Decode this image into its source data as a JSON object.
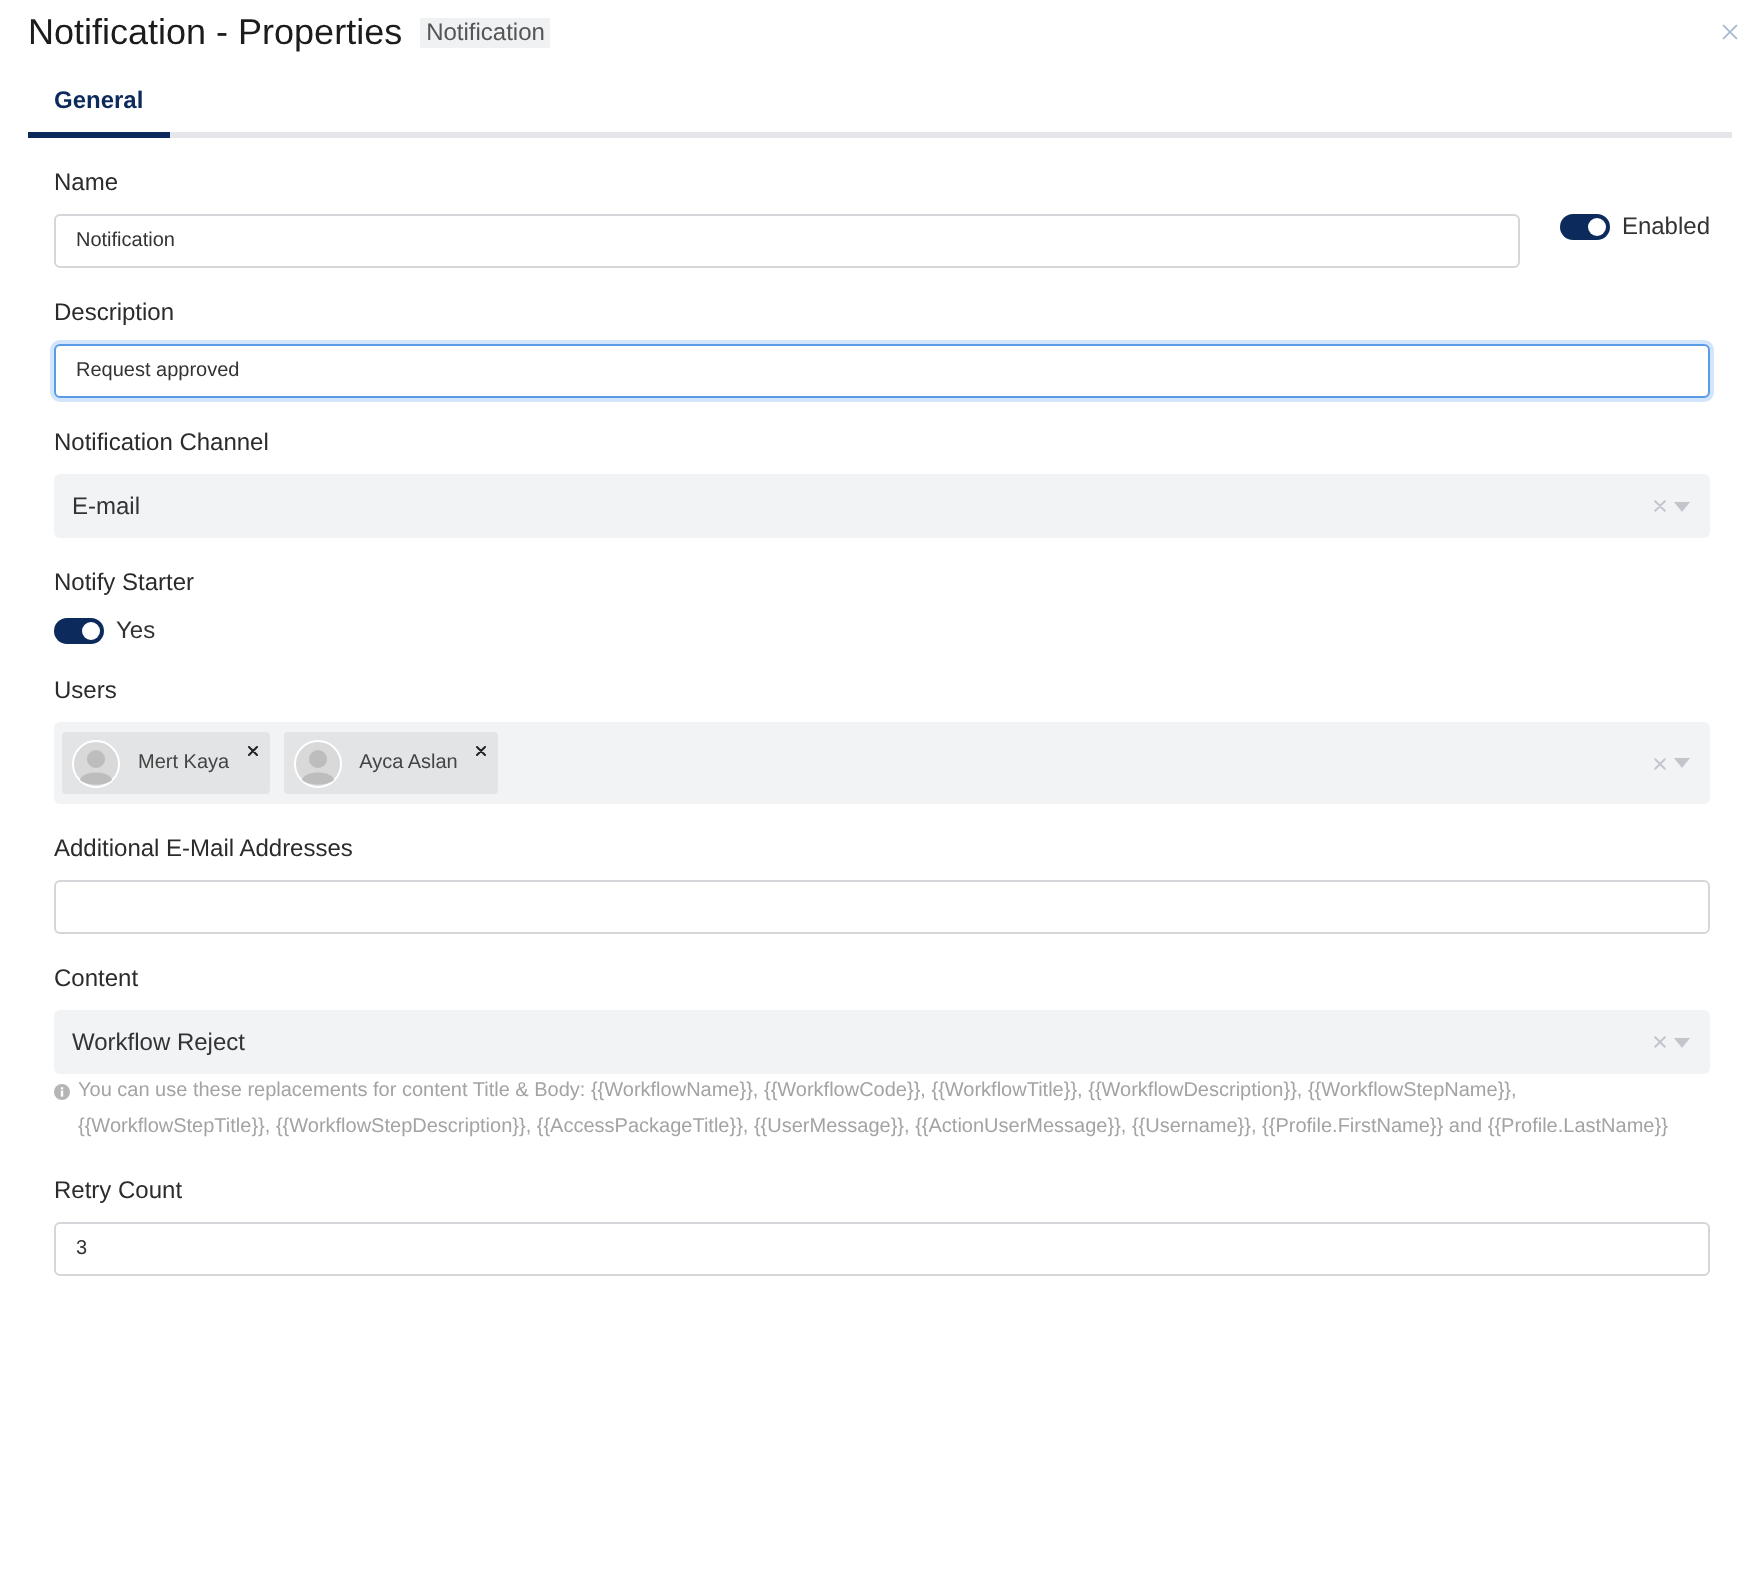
{
  "dialog": {
    "title": "Notification - Properties",
    "badge": "Notification"
  },
  "tabs": [
    {
      "label": "General",
      "selected": true
    }
  ],
  "fields": [
    {
      "kind": "text",
      "label": "Name",
      "value": "Notification",
      "focused": false,
      "toggle": {
        "label": "Enabled",
        "on": true
      }
    },
    {
      "kind": "text",
      "label": "Description",
      "value": "Request approved",
      "focused": true
    },
    {
      "kind": "select",
      "label": "Notification Channel",
      "value": "E-mail"
    },
    {
      "kind": "switch",
      "label": "Notify Starter",
      "toggle": {
        "label": "Yes",
        "on": true
      }
    },
    {
      "kind": "multiselect",
      "label": "Users",
      "chips": [
        "Mert Kaya",
        "Ayca Aslan"
      ]
    },
    {
      "kind": "text",
      "label": "Additional E-Mail Addresses",
      "focused": false
    },
    {
      "kind": "select",
      "label": "Content",
      "value": "Workflow Reject",
      "hint": "You can use these replacements for content Title & Body: {{WorkflowName}}, {{WorkflowCode}}, {{WorkflowTitle}}, {{WorkflowDescription}}, {{WorkflowStepName}}, {{WorkflowStepTitle}}, {{WorkflowStepDescription}}, {{AccessPackageTitle}}, {{UserMessage}}, {{ActionUserMessage}}, {{Username}}, {{Profile.FirstName}} and {{Profile.LastName}}"
    },
    {
      "kind": "text",
      "label": "Retry Count",
      "value": "3",
      "focused": false
    }
  ]
}
